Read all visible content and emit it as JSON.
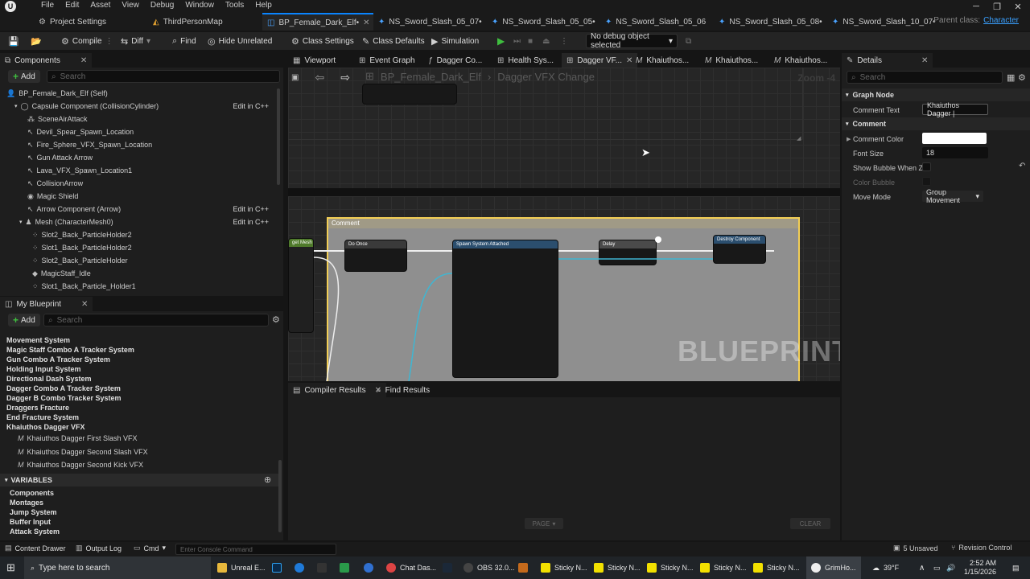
{
  "menu": {
    "items": [
      "File",
      "Edit",
      "Asset",
      "View",
      "Debug",
      "Window",
      "Tools",
      "Help"
    ]
  },
  "doc_tabs": [
    {
      "label": "Project Settings"
    },
    {
      "label": "ThirdPersonMap"
    },
    {
      "label": "BP_Female_Dark_Elf•",
      "active": true
    },
    {
      "label": "NS_Sword_Slash_05_07•"
    },
    {
      "label": "NS_Sword_Slash_05_05•"
    },
    {
      "label": "NS_Sword_Slash_05_06"
    },
    {
      "label": "NS_Sword_Slash_05_08•"
    },
    {
      "label": "NS_Sword_Slash_10_07•"
    }
  ],
  "parent_class": {
    "label": "Parent class:",
    "value": "Character"
  },
  "toolbar": {
    "compile": "Compile",
    "diff": "Diff",
    "find": "Find",
    "hide_unrelated": "Hide Unrelated",
    "class_settings": "Class Settings",
    "class_defaults": "Class Defaults",
    "simulation": "Simulation",
    "debug_object": "No debug object selected"
  },
  "components": {
    "tab": "Components",
    "add": "Add",
    "search_placeholder": "Search",
    "items": [
      {
        "label": "BP_Female_Dark_Elf (Self)"
      },
      {
        "label": "Capsule Component (CollisionCylinder)",
        "edit": "Edit in C++"
      },
      {
        "label": "SceneAirAttack"
      },
      {
        "label": "Devil_Spear_Spawn_Location"
      },
      {
        "label": "Fire_Sphere_VFX_Spawn_Location"
      },
      {
        "label": "Gun Attack Arrow"
      },
      {
        "label": "Lava_VFX_Spawn_Location1"
      },
      {
        "label": "CollisionArrow"
      },
      {
        "label": "Magic Shield"
      },
      {
        "label": "Arrow Component (Arrow)",
        "edit": "Edit in C++"
      },
      {
        "label": "Mesh (CharacterMesh0)",
        "edit": "Edit in C++"
      },
      {
        "label": "Slot2_Back_ParticleHolder2"
      },
      {
        "label": "Slot1_Back_ParticleHolder2"
      },
      {
        "label": "Slot2_Back_ParticleHolder"
      },
      {
        "label": "MagicStaff_Idle"
      },
      {
        "label": "Slot1_Back_Particle_Holder1"
      }
    ]
  },
  "my_blueprint": {
    "tab": "My Blueprint",
    "add": "Add",
    "search_placeholder": "Search",
    "graphs": [
      "Movement System",
      "Magic Staff Combo A Tracker System",
      "Gun Combo A Tracker System",
      "Holding Input System",
      "Directional Dash System",
      "Dagger Combo A Tracker System",
      "Dagger B Combo Tracker System",
      "Draggers Fracture",
      "End Fracture System",
      "Khaiuthos Dagger  VFX"
    ],
    "functions": [
      "Khaiuthos Dagger First Slash VFX",
      "Khaiuthos Dagger  Second Slash VFX",
      "Khaiuthos Dagger Second Kick VFX"
    ],
    "variables_header": "VARIABLES",
    "variables": [
      "Components",
      "Montages",
      "Jump System",
      "Buffer Input",
      "Attack System"
    ]
  },
  "graph_tabs": [
    {
      "label": "Viewport"
    },
    {
      "label": "Event Graph"
    },
    {
      "label": "Dagger Co..."
    },
    {
      "label": "Health Sys..."
    },
    {
      "label": "Dagger VF...",
      "active": true
    },
    {
      "label": "Khaiuthos..."
    },
    {
      "label": "Khaiuthos..."
    },
    {
      "label": "Khaiuthos..."
    }
  ],
  "graph": {
    "breadcrumb_root": "BP_Female_Dark_Elf",
    "breadcrumb_current": "Dagger VFX Change",
    "zoom": "Zoom -4",
    "watermark": "BLUEPRINT",
    "comment_title": "Comment",
    "nodes": {
      "n1": "Do Once",
      "n2": "Spawn System Attached",
      "n3": "Delay",
      "n4": "Destroy Component",
      "var": "get Mesh"
    }
  },
  "bottom_tabs": {
    "compiler": "Compiler Results",
    "find": "Find Results",
    "page": "PAGE",
    "clear": "CLEAR"
  },
  "details": {
    "tab": "Details",
    "search_placeholder": "Search",
    "graph_node": "Graph Node",
    "comment_text_label": "Comment Text",
    "comment_text_value": "Khaiuthos Dagger |",
    "comment_section": "Comment",
    "comment_color_label": "Comment Color",
    "font_size_label": "Font Size",
    "font_size_value": "18",
    "show_bubble_label": "Show Bubble When Z...",
    "color_bubble_label": "Color Bubble",
    "move_mode_label": "Move Mode",
    "move_mode_value": "Group Movement"
  },
  "statusbar": {
    "content_drawer": "Content Drawer",
    "output_log": "Output Log",
    "cmd": "Cmd",
    "console_placeholder": "Enter Console Command",
    "unsaved": "5 Unsaved",
    "revision": "Revision Control"
  },
  "taskbar": {
    "search_placeholder": "Type here to search",
    "apps": [
      "Unreal E...",
      "Chat Das...",
      "OBS 32.0...",
      "Sticky N...",
      "Sticky N...",
      "Sticky N...",
      "Sticky N...",
      "Sticky N...",
      "GrimHo..."
    ],
    "temperature": "39°F",
    "time": "2:52 AM",
    "date": "1/15/2026"
  }
}
